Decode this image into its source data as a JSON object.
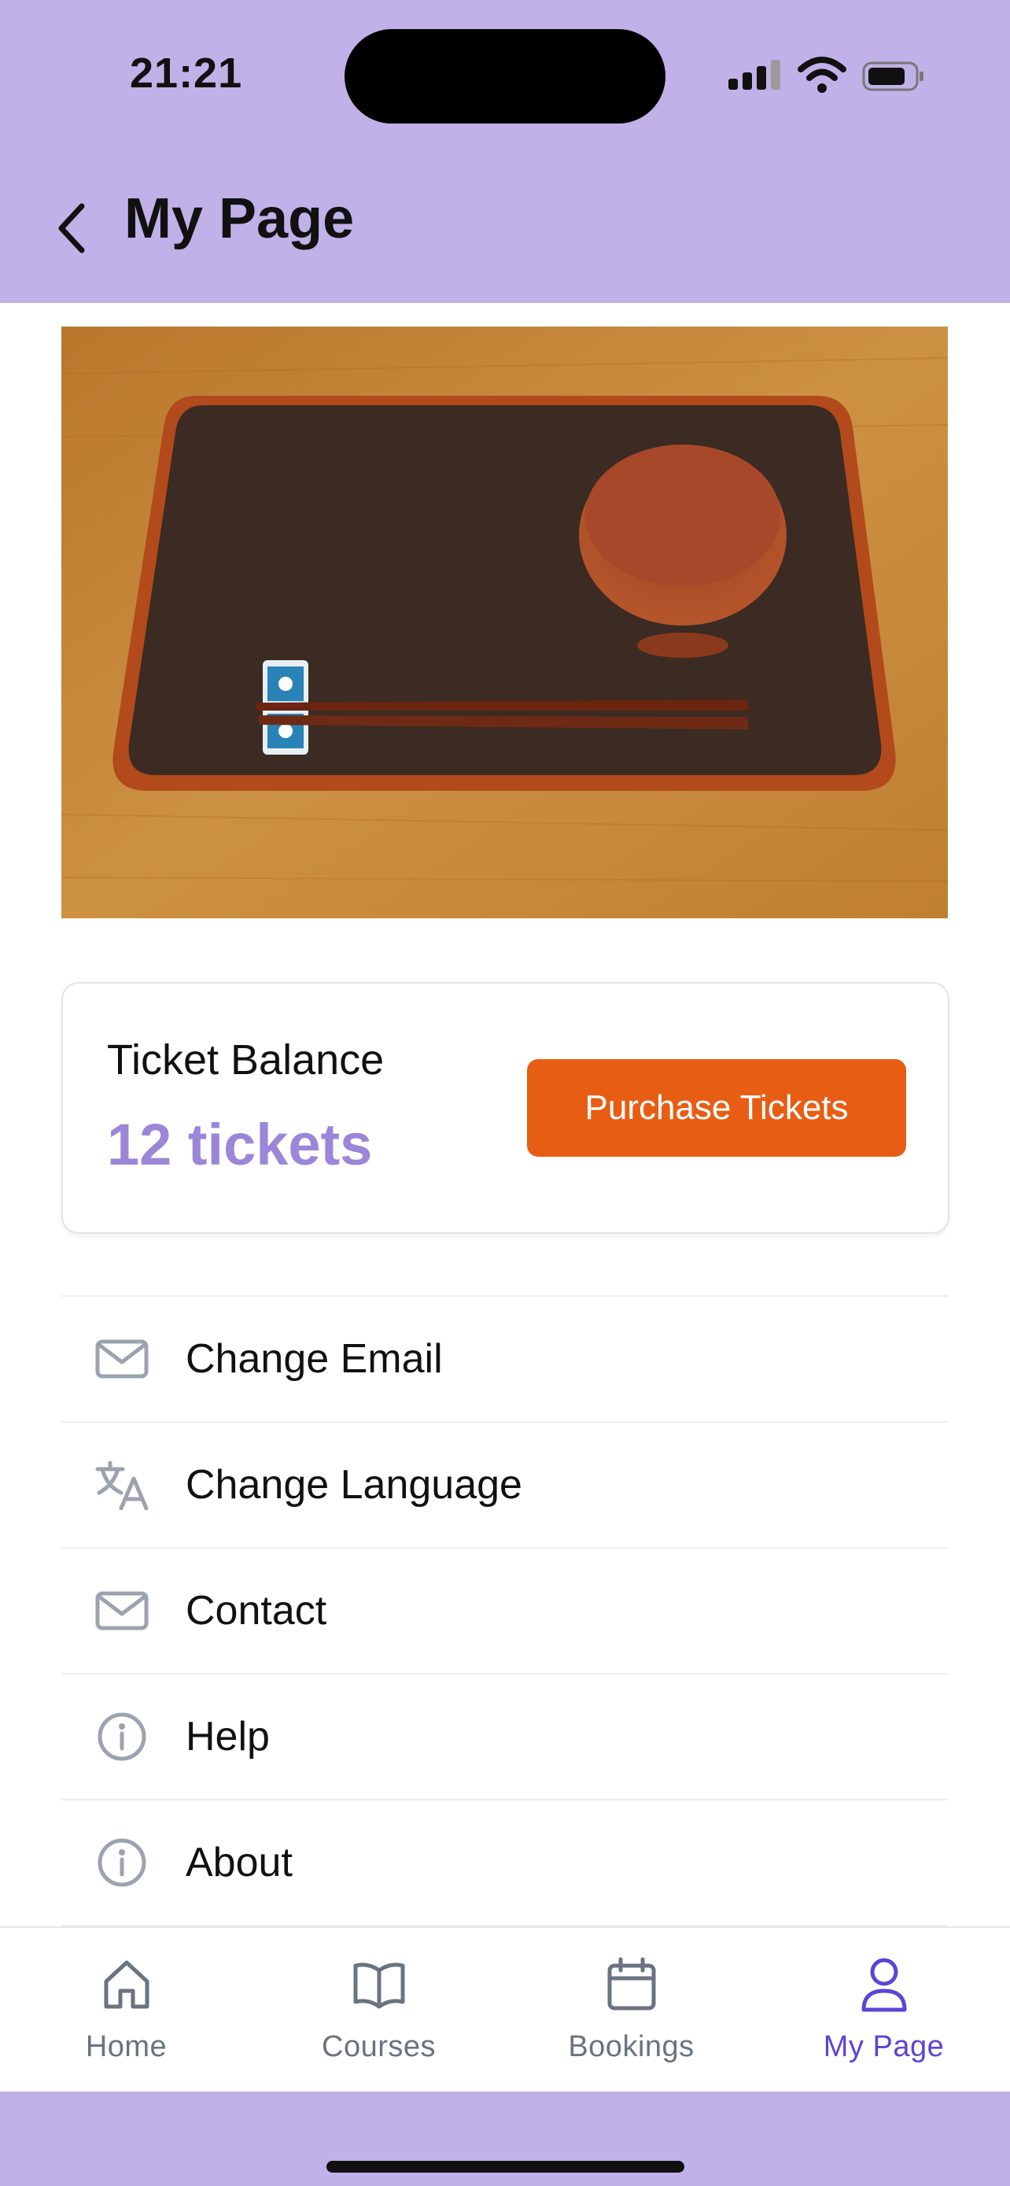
{
  "status_bar": {
    "time": "21:21",
    "icons": [
      "cellular-signal-icon",
      "wifi-icon",
      "battery-icon"
    ]
  },
  "header": {
    "title": "My Page",
    "back_icon": "chevron-left-icon"
  },
  "hero_image": {
    "subject": "lacquered tray with bowl and chopsticks on a chopstick rest"
  },
  "ticket_card": {
    "label": "Ticket Balance",
    "balance": "12 tickets",
    "button_label": "Purchase Tickets"
  },
  "menu": {
    "items": [
      {
        "label": "Change Email",
        "icon": "mail-icon"
      },
      {
        "label": "Change Language",
        "icon": "translate-icon"
      },
      {
        "label": "Contact",
        "icon": "mail-icon"
      },
      {
        "label": "Help",
        "icon": "info-icon"
      },
      {
        "label": "About",
        "icon": "info-icon"
      }
    ]
  },
  "tab_bar": {
    "tabs": [
      {
        "label": "Home",
        "icon": "home-icon",
        "active": false
      },
      {
        "label": "Courses",
        "icon": "book-icon",
        "active": false
      },
      {
        "label": "Bookings",
        "icon": "calendar-icon",
        "active": false
      },
      {
        "label": "My Page",
        "icon": "user-icon",
        "active": true
      }
    ]
  },
  "colors": {
    "header_bg": "#c0b1e8",
    "accent_purple": "#9b86d8",
    "active_tab": "#5a45d6",
    "purchase_button": "#e85d14",
    "icon_gray": "#9ca3af"
  }
}
